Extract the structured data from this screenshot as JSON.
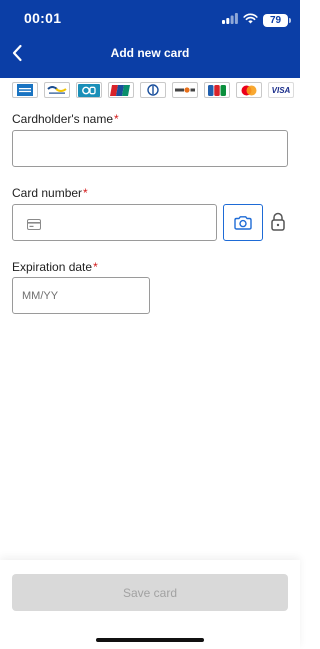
{
  "status_bar": {
    "time": "00:01",
    "battery": "79"
  },
  "header": {
    "title": "Add new card"
  },
  "brands": [
    {
      "name": "amex",
      "color": "#1a74c2"
    },
    {
      "name": "bancontact",
      "color": "#1b4d8f"
    },
    {
      "name": "cb",
      "color": "#1a8fb8"
    },
    {
      "name": "unionpay",
      "color": "#d8232a"
    },
    {
      "name": "diners",
      "color": "#1a4f9c"
    },
    {
      "name": "discover",
      "color": "#e8701a"
    },
    {
      "name": "jcb",
      "color": "#1f5fae"
    },
    {
      "name": "mastercard",
      "color": "#eb001b"
    },
    {
      "name": "visa",
      "label": "VISA",
      "color": "#1a2d8a"
    }
  ],
  "form": {
    "cardholder_label": "Cardholder's name",
    "cardholder_value": "",
    "card_number_label": "Card number",
    "card_number_value": "",
    "expiration_label": "Expiration date",
    "expiration_placeholder": "MM/YY",
    "required_mark": "*"
  },
  "footer": {
    "save_label": "Save card"
  },
  "colors": {
    "header_bg": "#0b3ea6",
    "accent": "#1e6bd6",
    "required": "#d31a1a",
    "disabled_bg": "#d9d9d9"
  }
}
